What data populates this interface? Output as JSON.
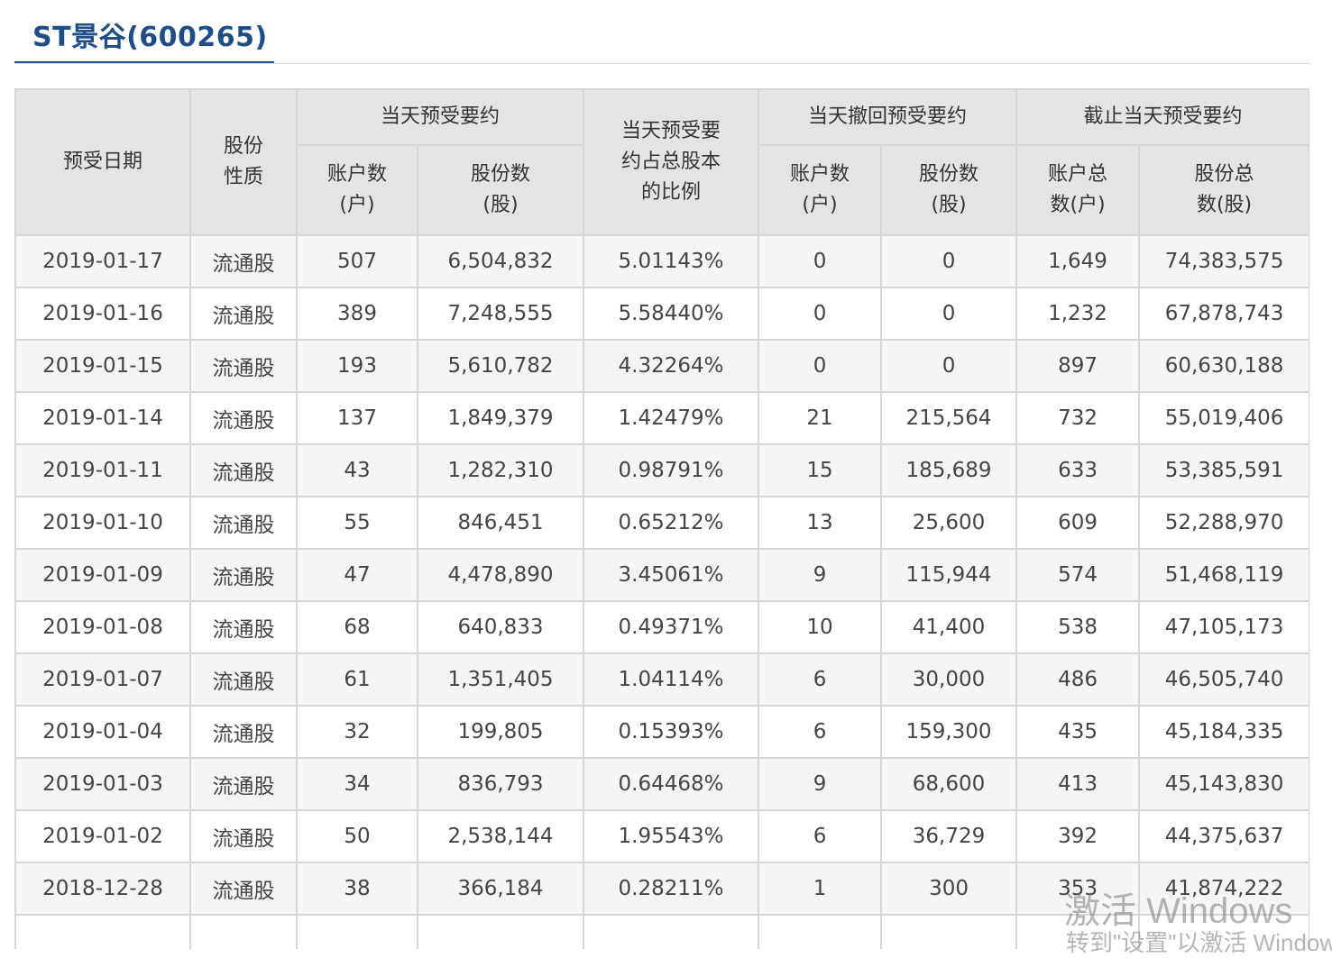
{
  "page": {
    "title": "ST景谷(600265)",
    "accent_color": "#1f5a96"
  },
  "table": {
    "headers": {
      "date": "预受日期",
      "share_type": "股份\n性质",
      "group_today": "当天预受要约",
      "ratio": "当天预受要\n约占总股本\n的比例",
      "group_withdraw": "当天撤回预受要约",
      "group_cumulative": "截止当天预受要约",
      "accounts_today": "账户数\n(户)",
      "shares_today": "股份数\n(股)",
      "accounts_withdraw": "账户数\n(户)",
      "shares_withdraw": "股份数\n(股)",
      "accounts_total": "账户总\n数(户)",
      "shares_total": "股份总\n数(股)"
    },
    "rows": [
      [
        "2019-01-17",
        "流通股",
        "507",
        "6,504,832",
        "5.01143%",
        "0",
        "0",
        "1,649",
        "74,383,575"
      ],
      [
        "2019-01-16",
        "流通股",
        "389",
        "7,248,555",
        "5.58440%",
        "0",
        "0",
        "1,232",
        "67,878,743"
      ],
      [
        "2019-01-15",
        "流通股",
        "193",
        "5,610,782",
        "4.32264%",
        "0",
        "0",
        "897",
        "60,630,188"
      ],
      [
        "2019-01-14",
        "流通股",
        "137",
        "1,849,379",
        "1.42479%",
        "21",
        "215,564",
        "732",
        "55,019,406"
      ],
      [
        "2019-01-11",
        "流通股",
        "43",
        "1,282,310",
        "0.98791%",
        "15",
        "185,689",
        "633",
        "53,385,591"
      ],
      [
        "2019-01-10",
        "流通股",
        "55",
        "846,451",
        "0.65212%",
        "13",
        "25,600",
        "609",
        "52,288,970"
      ],
      [
        "2019-01-09",
        "流通股",
        "47",
        "4,478,890",
        "3.45061%",
        "9",
        "115,944",
        "574",
        "51,468,119"
      ],
      [
        "2019-01-08",
        "流通股",
        "68",
        "640,833",
        "0.49371%",
        "10",
        "41,400",
        "538",
        "47,105,173"
      ],
      [
        "2019-01-07",
        "流通股",
        "61",
        "1,351,405",
        "1.04114%",
        "6",
        "30,000",
        "486",
        "46,505,740"
      ],
      [
        "2019-01-04",
        "流通股",
        "32",
        "199,805",
        "0.15393%",
        "6",
        "159,300",
        "435",
        "45,184,335"
      ],
      [
        "2019-01-03",
        "流通股",
        "34",
        "836,793",
        "0.64468%",
        "9",
        "68,600",
        "413",
        "45,143,830"
      ],
      [
        "2019-01-02",
        "流通股",
        "50",
        "2,538,144",
        "1.95543%",
        "6",
        "36,729",
        "392",
        "44,375,637"
      ],
      [
        "2018-12-28",
        "流通股",
        "38",
        "366,184",
        "0.28211%",
        "1",
        "300",
        "353",
        "41,874,222"
      ],
      [
        "",
        "",
        "",
        "",
        "",
        "",
        "",
        "",
        ""
      ]
    ]
  },
  "watermark": {
    "line1": "激活 Windows",
    "line2": "转到\"设置\"以激活 Windows"
  }
}
